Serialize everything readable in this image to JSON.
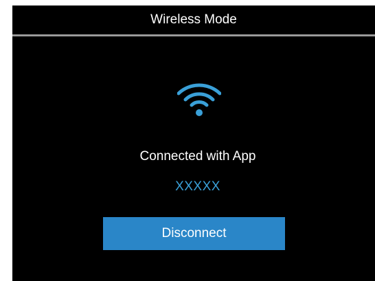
{
  "header": {
    "title": "Wireless Mode"
  },
  "status": {
    "icon": "wifi-icon",
    "text": "Connected with App",
    "device_name": "XXXXX"
  },
  "actions": {
    "disconnect_label": "Disconnect"
  },
  "colors": {
    "background": "#000000",
    "text": "#ffffff",
    "accent": "#3aa0d8",
    "button": "#2a86c8",
    "divider": "#9a9a9a"
  }
}
